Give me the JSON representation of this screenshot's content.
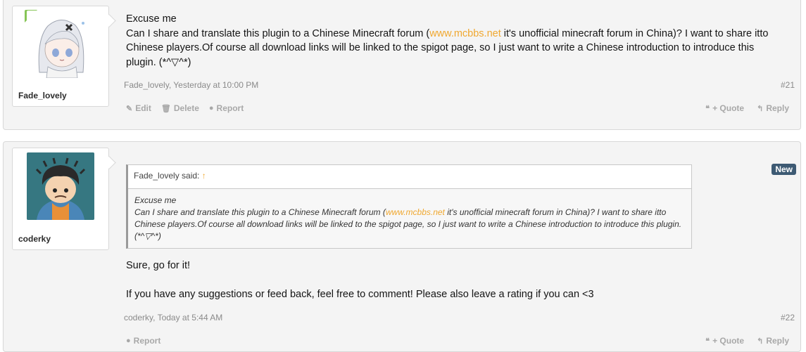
{
  "posts": [
    {
      "username": "Fade_lovely",
      "message": {
        "line1": "Excuse me",
        "p1": "Can I share and translate this plugin to a Chinese Minecraft forum (",
        "link": "www.mcbbs.net",
        "p2": " it's unofficial minecraft forum in China)? I want to share itto Chinese players.Of course all download links will be linked to the spigot page, so I just want to write a Chinese introduction to introduce this plugin. (*^▽^*)"
      },
      "meta": "Fade_lovely, Yesterday at 10:00 PM",
      "number": "#21",
      "actions": {
        "edit": "Edit",
        "delete": "Delete",
        "report": "Report",
        "quote": "+ Quote",
        "reply": "Reply"
      }
    },
    {
      "username": "coderky",
      "badge": "New",
      "quote": {
        "header": "Fade_lovely said:",
        "arrow": "↑",
        "line1": "Excuse me",
        "p1": "Can I share and translate this plugin to a Chinese Minecraft forum (",
        "link": "www.mcbbs.net",
        "p2": " it's unofficial minecraft forum in China)? I want to share itto Chinese players.Of course all download links will be linked to the spigot page, so I just want to write a Chinese introduction to introduce this plugin. (*^▽^*)"
      },
      "message": {
        "line1": "Sure, go for it!",
        "line2": "If you have any suggestions or feed back, feel free to comment! Please also leave a rating if you can <3"
      },
      "meta": "coderky, Today at 5:44 AM",
      "number": "#22",
      "actions": {
        "report": "Report",
        "quote": "+ Quote",
        "reply": "Reply"
      }
    }
  ],
  "icons": {
    "edit": "pencil-icon",
    "delete": "trash-icon",
    "report": "alert-icon",
    "quote": "quote-icon",
    "reply": "reply-icon"
  },
  "colors": {
    "link": "#f0a830",
    "new_badge": "#3d5a73",
    "new_user_marker": "#86c556"
  }
}
